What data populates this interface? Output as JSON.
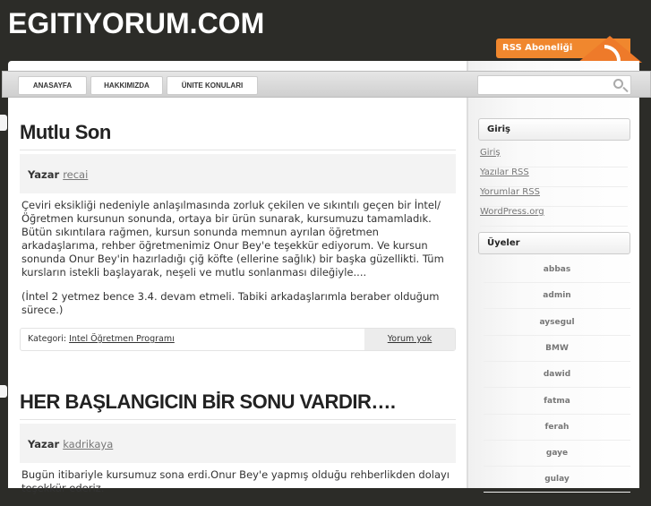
{
  "header": {
    "site_title": "EGITIYORUM.COM",
    "rss_label": "RSS Aboneliği"
  },
  "nav": {
    "items": [
      "ANASAYFA",
      "HAKKIMIZDA",
      "ÜNITE KONULARI"
    ],
    "search_placeholder": ""
  },
  "posts": [
    {
      "title": "Mutlu Son",
      "author_label": "Yazar",
      "author": "recai",
      "paragraphs": [
        "Çeviri eksikliği nedeniyle anlaşılmasında zorluk çekilen ve sıkıntılı geçen bir İntel/Öğretmen kursunun sonunda, ortaya bir ürün sunarak, kursumuzu  tamamladık. Bütün sıkıntılara rağmen, kursun sonunda memnun ayrılan öğretmen arkadaşlarıma, rehber öğretmenimiz Onur Bey'e teşekkür ediyorum. Ve kursun sonunda Onur Bey'in hazırladığı çiğ köfte (ellerine sağlık) bir başka güzellikti. Tüm kursların istekli başlayarak, neşeli ve mutlu sonlanması dileğiyle....",
        " (İntel 2 yetmez bence 3.4. devam etmeli. Tabiki arkadaşlarımla beraber olduğum sürece.)"
      ],
      "category_label": "Kategori:",
      "category": "Intel Öğretmen Programı",
      "comments": "Yorum yok"
    },
    {
      "title": "HER BAŞLANGICIN BİR SONU VARDIR….",
      "author_label": "Yazar",
      "author": "kadrikaya",
      "paragraphs": [
        "Bugün itibariyle kursumuz sona erdi.Onur Bey'e yapmış olduğu rehberlikden dolayı teşekkür ederiz."
      ]
    }
  ],
  "sidebar": {
    "login_title": "Giriş",
    "login_links": [
      "Giriş",
      "Yazılar RSS",
      "Yorumlar RSS",
      "WordPress.org"
    ],
    "members_title": "Üyeler",
    "members": [
      "abbas",
      "admin",
      "aysegul",
      "BMW",
      "dawid",
      "fatma",
      "ferah",
      "gaye",
      "gulay"
    ]
  }
}
